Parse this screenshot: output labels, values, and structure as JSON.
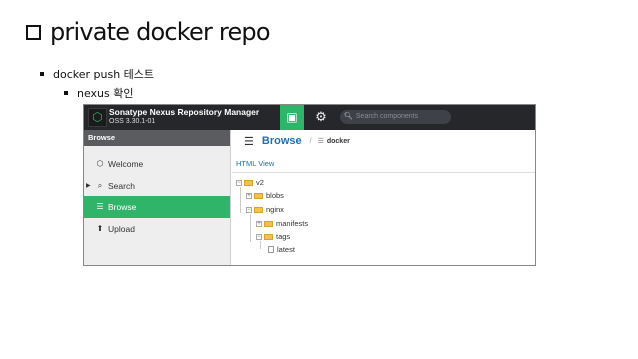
{
  "slide": {
    "title": "private docker repo",
    "bullet_level1": "docker push 테스트",
    "bullet_level2": "nexus 확인"
  },
  "app": {
    "name": "Sonatype Nexus Repository Manager",
    "version": "OSS 3.30.1-01",
    "search_placeholder": "Search components"
  },
  "sidebar": {
    "header": "Browse",
    "items": [
      {
        "label": "Welcome",
        "icon": "hexagon-icon"
      },
      {
        "label": "Search",
        "icon": "search-icon"
      },
      {
        "label": "Browse",
        "icon": "database-icon",
        "active": true
      },
      {
        "label": "Upload",
        "icon": "upload-icon"
      }
    ]
  },
  "content": {
    "heading": "Browse",
    "separator": "/",
    "repository": "docker",
    "html_view": "HTML View",
    "tree": [
      {
        "label": "v2",
        "depth": 0,
        "type": "folder"
      },
      {
        "label": "blobs",
        "depth": 1,
        "type": "folder"
      },
      {
        "label": "nginx",
        "depth": 1,
        "type": "folder"
      },
      {
        "label": "manifests",
        "depth": 2,
        "type": "folder"
      },
      {
        "label": "tags",
        "depth": 2,
        "type": "folder"
      },
      {
        "label": "latest",
        "depth": 3,
        "type": "file"
      }
    ]
  },
  "colors": {
    "accent": "#2fb46a",
    "topbar": "#25272b",
    "link": "#1f6fb5"
  }
}
